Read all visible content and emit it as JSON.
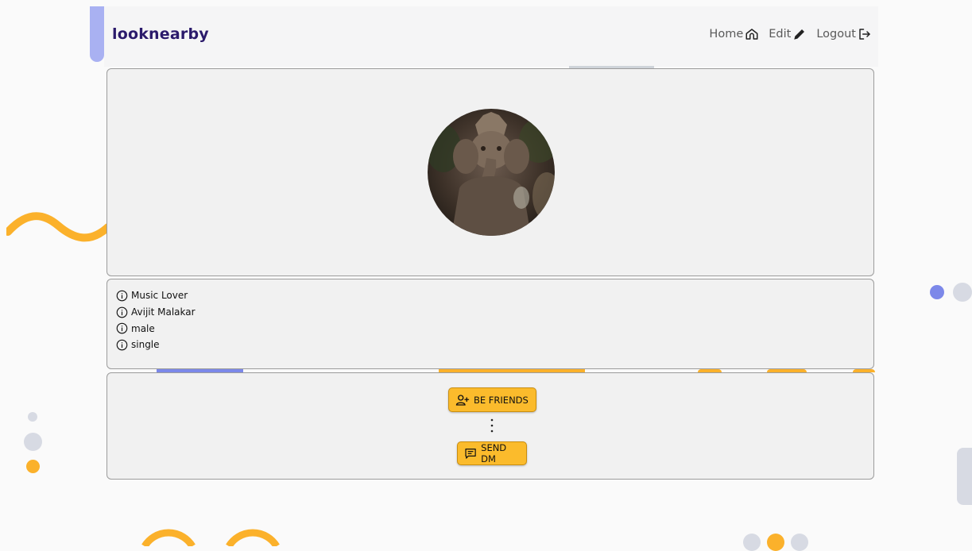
{
  "brand": {
    "name": "looknearby"
  },
  "nav": {
    "items": [
      {
        "label": "Home",
        "icon": "home-icon"
      },
      {
        "label": "Edit",
        "icon": "pencil-icon"
      },
      {
        "label": "Logout",
        "icon": "logout-icon"
      }
    ]
  },
  "profile": {
    "photo_alt": "profile photo",
    "info": [
      {
        "text": "Music Lover",
        "icon": "info-icon"
      },
      {
        "text": "Avijit Malakar",
        "icon": "info-icon"
      },
      {
        "text": "male",
        "icon": "info-icon"
      },
      {
        "text": "single",
        "icon": "info-icon"
      }
    ]
  },
  "actions": {
    "be_friends_label": "BE FRIENDS",
    "send_dm_label": "SEND DM"
  },
  "colors": {
    "accent": "#fbbb2c",
    "brand": "#2b1a6b",
    "deco_blue": "#a9b1f2",
    "deco_gray": "#d7dae3"
  }
}
